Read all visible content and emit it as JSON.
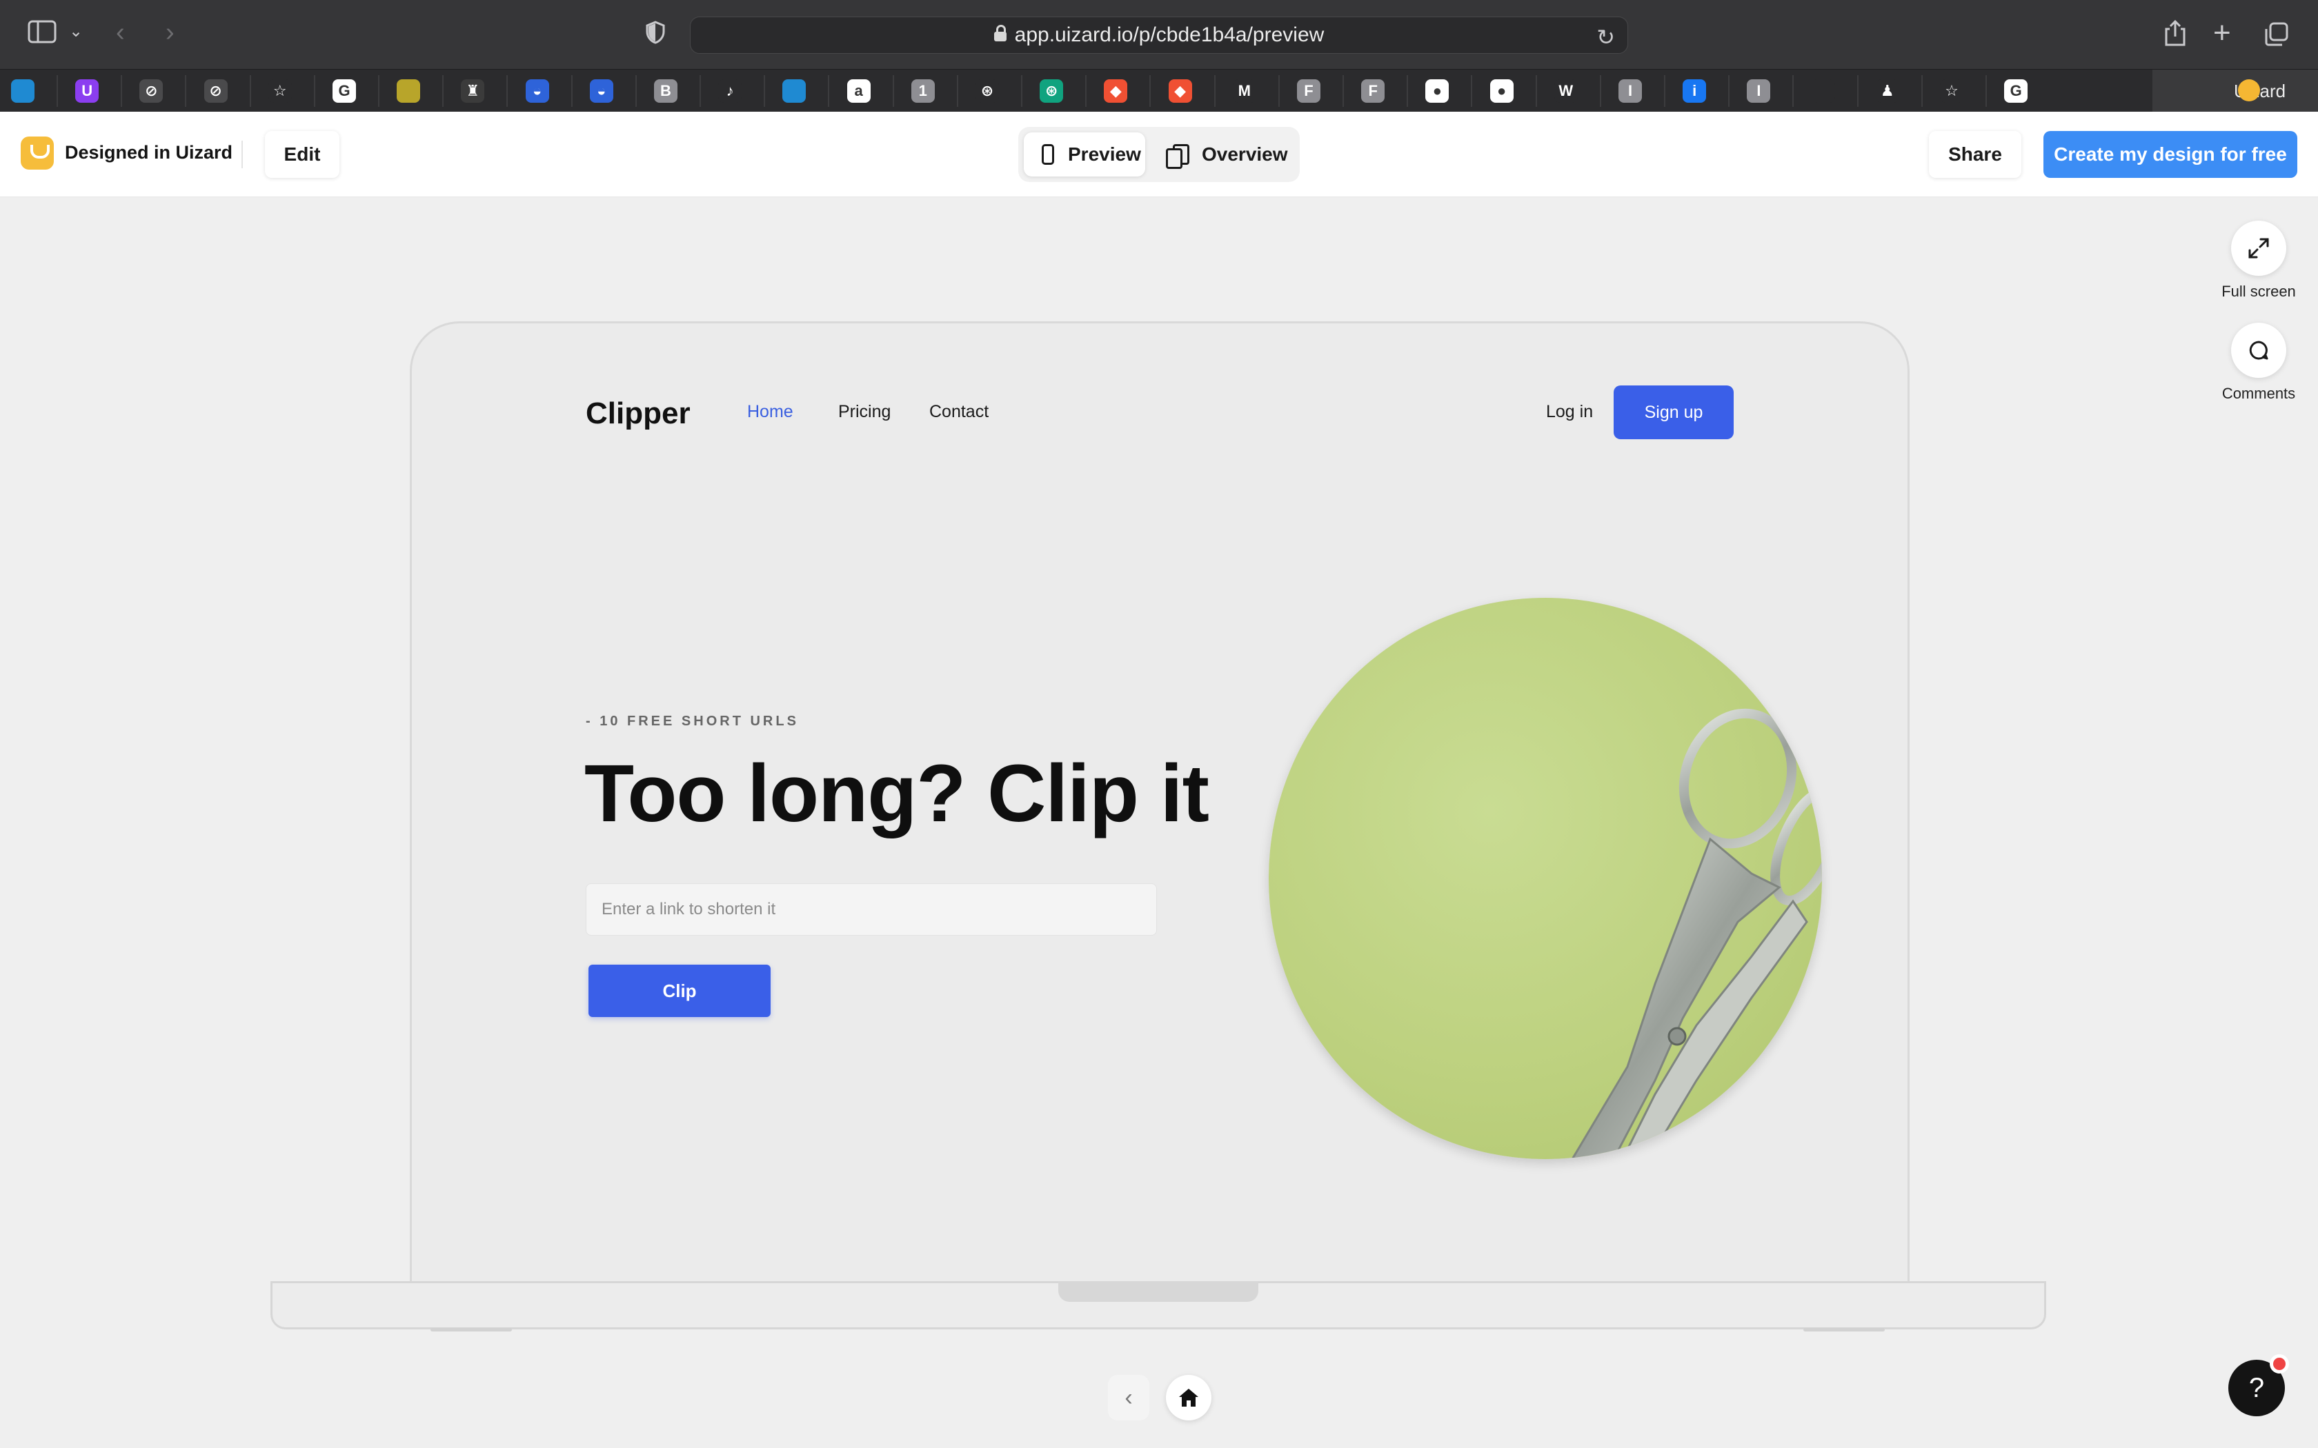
{
  "browser": {
    "url": "app.uizard.io/p/cbde1b4a/preview",
    "active_tab_label": "Uizard",
    "favorites": [
      {
        "icon": "vscode-icon",
        "letter": "",
        "color": "#1f8ad2"
      },
      {
        "icon": "uizard-purple-icon",
        "letter": "U",
        "color": "#8b3ef0"
      },
      {
        "icon": "compass-icon",
        "letter": "⊘",
        "color": "#4a4a4c"
      },
      {
        "icon": "compass-icon",
        "letter": "⊘",
        "color": "#4a4a4c"
      },
      {
        "icon": "star-icon",
        "letter": "☆",
        "color": "#2b2b2d"
      },
      {
        "icon": "google-icon",
        "letter": "G",
        "color": "#ffffff"
      },
      {
        "icon": "colorbar-icon",
        "letter": "",
        "color": "#b8a52a"
      },
      {
        "icon": "castle-icon",
        "letter": "♜",
        "color": "#3b3b3b"
      },
      {
        "icon": "sunrise-icon",
        "letter": "◒",
        "color": "#2e63d9"
      },
      {
        "icon": "sunrise-icon",
        "letter": "◒",
        "color": "#2e63d9"
      },
      {
        "icon": "b-icon",
        "letter": "B",
        "color": "#8e8e93"
      },
      {
        "icon": "music-icon",
        "letter": "♪",
        "color": "#2b2b2d"
      },
      {
        "icon": "vscode-icon",
        "letter": "",
        "color": "#1f8ad2"
      },
      {
        "icon": "a-icon",
        "letter": "a",
        "color": "#ffffff"
      },
      {
        "icon": "one-icon",
        "letter": "1",
        "color": "#8e8e93"
      },
      {
        "icon": "openai-icon",
        "letter": "⊛",
        "color": "#2b2b2d"
      },
      {
        "icon": "openai-green-icon",
        "letter": "⊛",
        "color": "#10a37f"
      },
      {
        "icon": "git-icon",
        "letter": "◆",
        "color": "#f05033"
      },
      {
        "icon": "git-icon",
        "letter": "◆",
        "color": "#f05033"
      },
      {
        "icon": "gmail-icon",
        "letter": "M",
        "color": "#2b2b2d"
      },
      {
        "icon": "f-icon",
        "letter": "F",
        "color": "#8e8e93"
      },
      {
        "icon": "f-icon",
        "letter": "F",
        "color": "#8e8e93"
      },
      {
        "icon": "github-icon",
        "letter": "●",
        "color": "#ffffff"
      },
      {
        "icon": "github-icon",
        "letter": "●",
        "color": "#ffffff"
      },
      {
        "icon": "w-icon",
        "letter": "W",
        "color": "#2b2b2d"
      },
      {
        "icon": "i-icon",
        "letter": "I",
        "color": "#8e8e93"
      },
      {
        "icon": "info-icon",
        "letter": "i",
        "color": "#1877f2"
      },
      {
        "icon": "i-icon",
        "letter": "I",
        "color": "#8e8e93"
      },
      {
        "icon": "mills-icon",
        "letter": "",
        "color": "#2b2b2d"
      },
      {
        "icon": "figure-icon",
        "letter": "♟",
        "color": "#2b2b2d"
      },
      {
        "icon": "star-icon",
        "letter": "☆",
        "color": "#2b2b2d"
      },
      {
        "icon": "google-icon",
        "letter": "G",
        "color": "#ffffff"
      }
    ]
  },
  "uizard": {
    "brand_label": "Designed in Uizard",
    "edit_label": "Edit",
    "preview_label": "Preview",
    "overview_label": "Overview",
    "share_label": "Share",
    "cta_label": "Create my design for free",
    "fullscreen_label": "Full screen",
    "comments_label": "Comments",
    "help_label": "?",
    "accent": "#3c8df5"
  },
  "site": {
    "logo": "Clipper",
    "nav": [
      {
        "label": "Home",
        "active": true
      },
      {
        "label": "Pricing",
        "active": false
      },
      {
        "label": "Contact",
        "active": false
      }
    ],
    "login_label": "Log in",
    "signup_label": "Sign up",
    "kicker": "- 10 FREE SHORT URLS",
    "headline": "Too long? Clip it",
    "input_placeholder": "Enter a link to shorten it",
    "input_value": "",
    "clip_label": "Clip",
    "accent": "#3a5fe8",
    "hero_image_subject": "scissors-on-green-background"
  }
}
